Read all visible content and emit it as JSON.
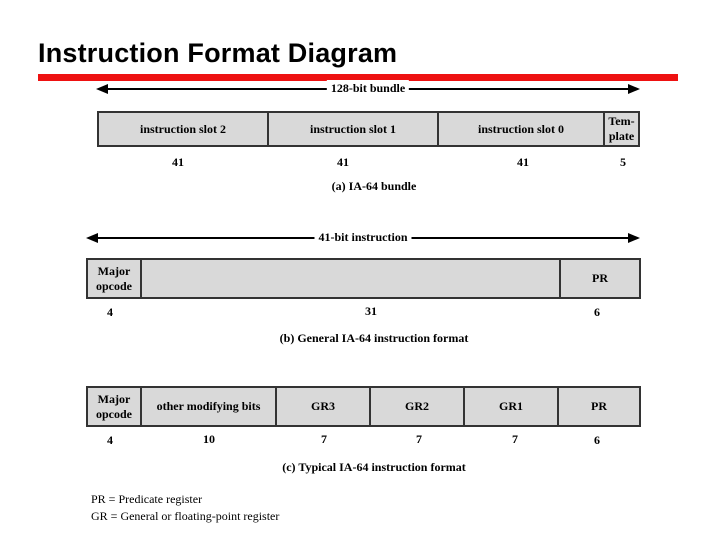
{
  "title": "Instruction Format Diagram",
  "colors": {
    "accent_bar": "#ee1111",
    "field_fill": "#d9d9d9"
  },
  "diagram_a": {
    "span_label": "128-bit bundle",
    "fields": [
      {
        "label": "instruction slot 2",
        "bits": "41"
      },
      {
        "label": "instruction slot 1",
        "bits": "41"
      },
      {
        "label": "instruction slot 0",
        "bits": "41"
      },
      {
        "label": "Tem-\nplate",
        "bits": "5"
      }
    ],
    "caption": "(a) IA-64 bundle"
  },
  "diagram_b": {
    "span_label": "41-bit instruction",
    "fields": [
      {
        "label": "Major\nopcode",
        "bits": "4"
      },
      {
        "label": "",
        "bits": "31"
      },
      {
        "label": "PR",
        "bits": "6"
      }
    ],
    "caption": "(b) General IA-64 instruction format"
  },
  "diagram_c": {
    "fields": [
      {
        "label": "Major\nopcode",
        "bits": "4"
      },
      {
        "label": "other modifying bits",
        "bits": "10"
      },
      {
        "label": "GR3",
        "bits": "7"
      },
      {
        "label": "GR2",
        "bits": "7"
      },
      {
        "label": "GR1",
        "bits": "7"
      },
      {
        "label": "PR",
        "bits": "6"
      }
    ],
    "caption": "(c) Typical IA-64 instruction format"
  },
  "legend": [
    "PR = Predicate register",
    "GR = General or floating-point register"
  ]
}
